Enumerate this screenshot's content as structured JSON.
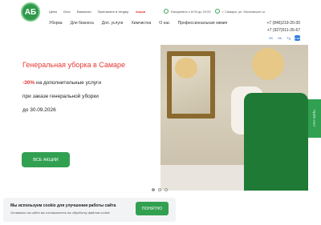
{
  "header": {
    "logo_text": "АБ",
    "top_links": [
      "Цены",
      "Блог",
      "Вакансии",
      "Пригласить в тендер"
    ],
    "promo_link": "Акции",
    "hours": "Ежедневно с 8:00 до 20:00",
    "address": "г. Самара, ул. Московское ш.",
    "main_nav": [
      "Уборка",
      "Для бизнеса",
      "Доп. услуги",
      "Химчистка",
      "О нас",
      "Профессиональная химия"
    ],
    "phones": [
      "+7 (846)219-20-30",
      "+7 (927)011-26-67"
    ],
    "socials": [
      "VK",
      "Ok",
      "Tg",
      "Inst"
    ]
  },
  "hero": {
    "title": "Генеральная уборка в Самаре",
    "discount": "-30%",
    "sub1_rest": " на дополнительные услуги",
    "sub2": "при заказе генеральной уборки",
    "sub3": "до 30.09.2026",
    "button": "ВСЕ АКЦИИ",
    "slides": 3,
    "active_slide": 1
  },
  "side_tab": "Прайс-лист",
  "cookie": {
    "title": "Мы используем cookie для улучшения работы сайта",
    "text": "Оставаясь на сайте вы соглашаетесь на обработку файлов cookie",
    "button": "ПОНЯТНО"
  },
  "colors": {
    "brand_green": "#31a051",
    "accent_red": "#e53935"
  }
}
